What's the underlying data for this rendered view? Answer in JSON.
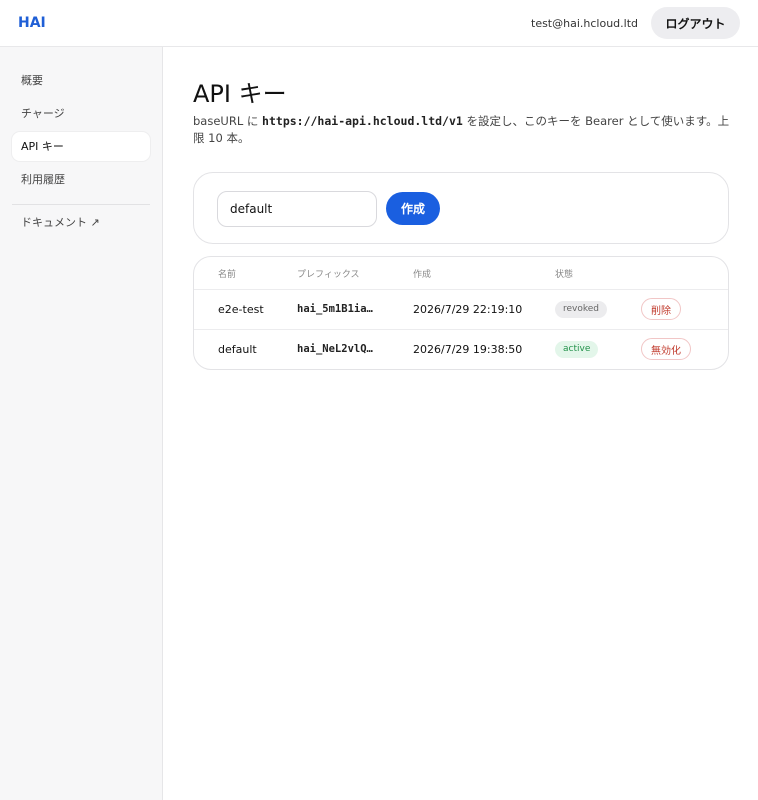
{
  "header": {
    "brand": "HAI",
    "user_email": "test@hai.hcloud.ltd",
    "logout_label": "ログアウト"
  },
  "sidebar": {
    "items": [
      {
        "label": "概要"
      },
      {
        "label": "チャージ"
      },
      {
        "label": "API キー",
        "active": true
      },
      {
        "label": "利用履歴"
      },
      {
        "label": "ドキュメント ↗"
      }
    ]
  },
  "main": {
    "title": "API キー",
    "desc_pre": "baseURL に ",
    "desc_code": "https://hai-api.hcloud.ltd/v1",
    "desc_post": " を設定し、このキーを Bearer として使います。上限 10 本。",
    "create": {
      "input_value": "default",
      "button_label": "作成"
    },
    "table": {
      "headers": [
        "名前",
        "プレフィックス",
        "作成",
        "状態"
      ],
      "rows": [
        {
          "name": "e2e-test",
          "prefix": "hai_5m1B1ia…",
          "created": "2026/7/29 22:19:10",
          "status": "revoked",
          "action": "削除"
        },
        {
          "name": "default",
          "prefix": "hai_NeL2vlQ…",
          "created": "2026/7/29 19:38:50",
          "status": "active",
          "action": "無効化"
        }
      ]
    }
  },
  "colors": {
    "accent": "#1a5fe0",
    "brand": "#1f5fd6",
    "active_status": "#23924b",
    "danger": "#c0392b"
  }
}
